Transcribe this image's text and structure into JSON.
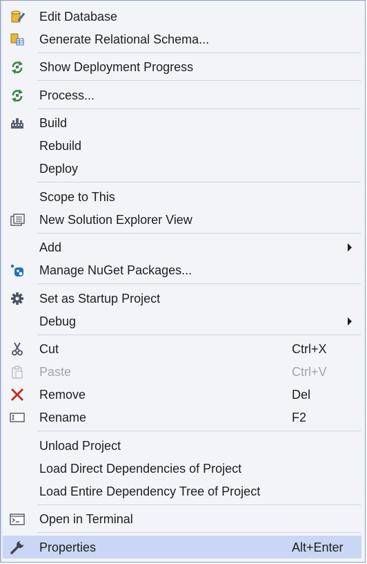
{
  "menu": {
    "items": [
      {
        "label": "Edit Database",
        "icon": "edit-database-icon"
      },
      {
        "label": "Generate Relational Schema...",
        "icon": "schema-icon"
      },
      {
        "label": "Show Deployment Progress",
        "icon": "deployment-progress-icon"
      },
      {
        "label": "Process...",
        "icon": "process-icon"
      },
      {
        "label": "Build",
        "icon": "build-icon"
      },
      {
        "label": "Rebuild"
      },
      {
        "label": "Deploy"
      },
      {
        "label": "Scope to This"
      },
      {
        "label": "New Solution Explorer View",
        "icon": "solution-explorer-view-icon"
      },
      {
        "label": "Add",
        "submenu": true
      },
      {
        "label": "Manage NuGet Packages...",
        "icon": "nuget-icon"
      },
      {
        "label": "Set as Startup Project",
        "icon": "gear-icon"
      },
      {
        "label": "Debug",
        "submenu": true
      },
      {
        "label": "Cut",
        "shortcut": "Ctrl+X",
        "icon": "scissors-icon"
      },
      {
        "label": "Paste",
        "shortcut": "Ctrl+V",
        "icon": "paste-icon",
        "disabled": true
      },
      {
        "label": "Remove",
        "shortcut": "Del",
        "icon": "remove-x-icon"
      },
      {
        "label": "Rename",
        "shortcut": "F2",
        "icon": "rename-icon"
      },
      {
        "label": "Unload Project"
      },
      {
        "label": "Load Direct Dependencies of Project"
      },
      {
        "label": "Load Entire Dependency Tree of Project"
      },
      {
        "label": "Open in Terminal",
        "icon": "terminal-icon"
      },
      {
        "label": "Properties",
        "shortcut": "Alt+Enter",
        "icon": "wrench-icon",
        "selected": true
      }
    ]
  },
  "colors": {
    "menu_background": "#f2f4f8",
    "selected_background": "#c9d6f4",
    "border": "#8a9bc6",
    "text": "#1e1e1e",
    "disabled_text": "#a2a4a5",
    "remove_red": "#c42b1c",
    "accent_blue": "#1e6fc9"
  }
}
